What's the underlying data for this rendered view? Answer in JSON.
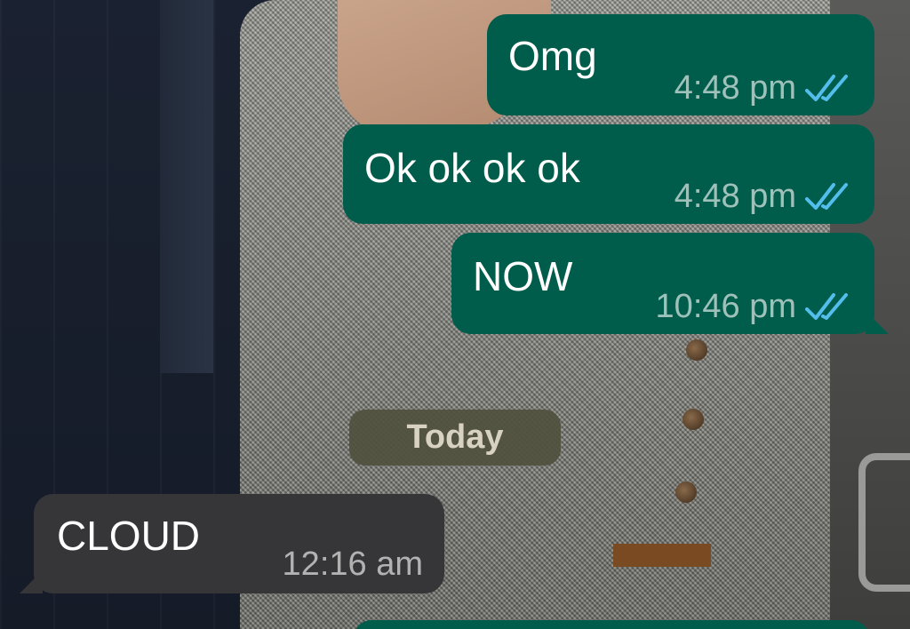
{
  "chat": {
    "messages": [
      {
        "text": "Omg",
        "time": "4:48 pm",
        "direction": "outgoing",
        "status": "read"
      },
      {
        "text": "Ok ok ok ok",
        "time": "4:48 pm",
        "direction": "outgoing",
        "status": "read"
      },
      {
        "text": "NOW",
        "time": "10:46 pm",
        "direction": "outgoing",
        "status": "read"
      },
      {
        "text": "CLOUD",
        "time": "12:16 am",
        "direction": "incoming"
      }
    ],
    "date_separator": "Today"
  },
  "colors": {
    "outgoing_bubble": "#005c4b",
    "incoming_bubble": "#363638",
    "read_ticks": "#53bdeb"
  },
  "icons": {
    "read_receipt": "double-check-icon"
  }
}
